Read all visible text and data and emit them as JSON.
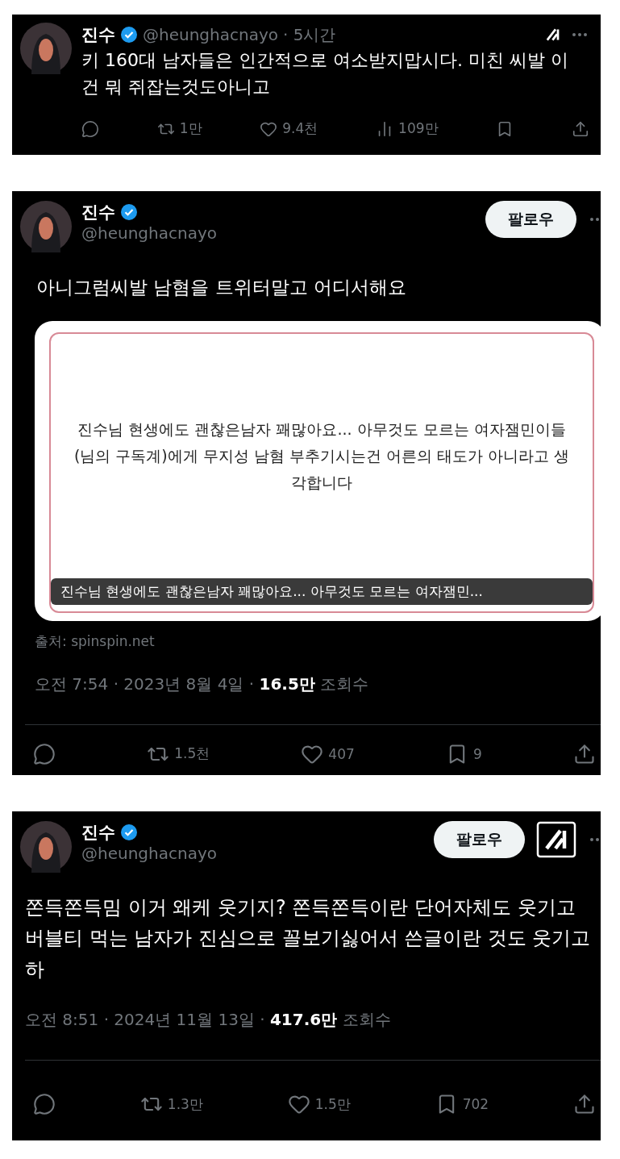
{
  "tweets": [
    {
      "kind": "compact",
      "name": "진수",
      "handle": "@heunghacnayo",
      "time": "· 5시간",
      "grok": true,
      "body": "키 160대 남자들은 인간적으로 여소받지맙시다. 미친 씨발 이건 뭐 쥐잡는것도아니고",
      "actions": [
        {
          "kind": "reply"
        },
        {
          "kind": "retweet",
          "count": "1만"
        },
        {
          "kind": "like",
          "count": "9.4천"
        },
        {
          "kind": "views",
          "count": "109만"
        },
        {
          "kind": "bookmark"
        },
        {
          "kind": "share"
        }
      ]
    },
    {
      "kind": "full",
      "name": "진수",
      "handle": "@heunghacnayo",
      "follow": "팔로우",
      "grok": false,
      "body": "아니그럼씨발 남혐을 트위터말고 어디서해요",
      "media": {
        "text": "진수님 현생에도 괜찮은남자 꽤많아요... 아무것도 모르는 여자잼민이들(님의 구독계)에게 무지성 남혐 부추기시는건 어른의 태도가 아니라고 생각합니다",
        "caption": "진수님 현생에도 괜찮은남자 꽤많아요... 아무것도 모르는 여자잼민..."
      },
      "source": "출처: spinspin.net",
      "stamp": "오전 7:54 · 2023년 8월 4일 · **16.5만** 조회수",
      "actions": [
        {
          "kind": "reply"
        },
        {
          "kind": "retweet",
          "count": "1.5천"
        },
        {
          "kind": "like",
          "count": "407"
        },
        {
          "kind": "bookmark",
          "count": "9"
        },
        {
          "kind": "share"
        }
      ]
    },
    {
      "kind": "full",
      "name": "진수",
      "handle": "@heunghacnayo",
      "follow": "팔로우",
      "grok": true,
      "body": "쫀득쫀득밈 이거 왜케 웃기지? 쫀득쫀득이란 단어자체도 웃기고 버블티 먹는 남자가 진심으로 꼴보기싫어서 쓴글이란 것도 웃기고 하",
      "stamp": "오전 8:51 · 2024년 11월 13일 · **417.6만** 조회수",
      "actions": [
        {
          "kind": "reply"
        },
        {
          "kind": "retweet",
          "count": "1.3만"
        },
        {
          "kind": "like",
          "count": "1.5만"
        },
        {
          "kind": "bookmark",
          "count": "702"
        },
        {
          "kind": "share"
        }
      ]
    }
  ]
}
